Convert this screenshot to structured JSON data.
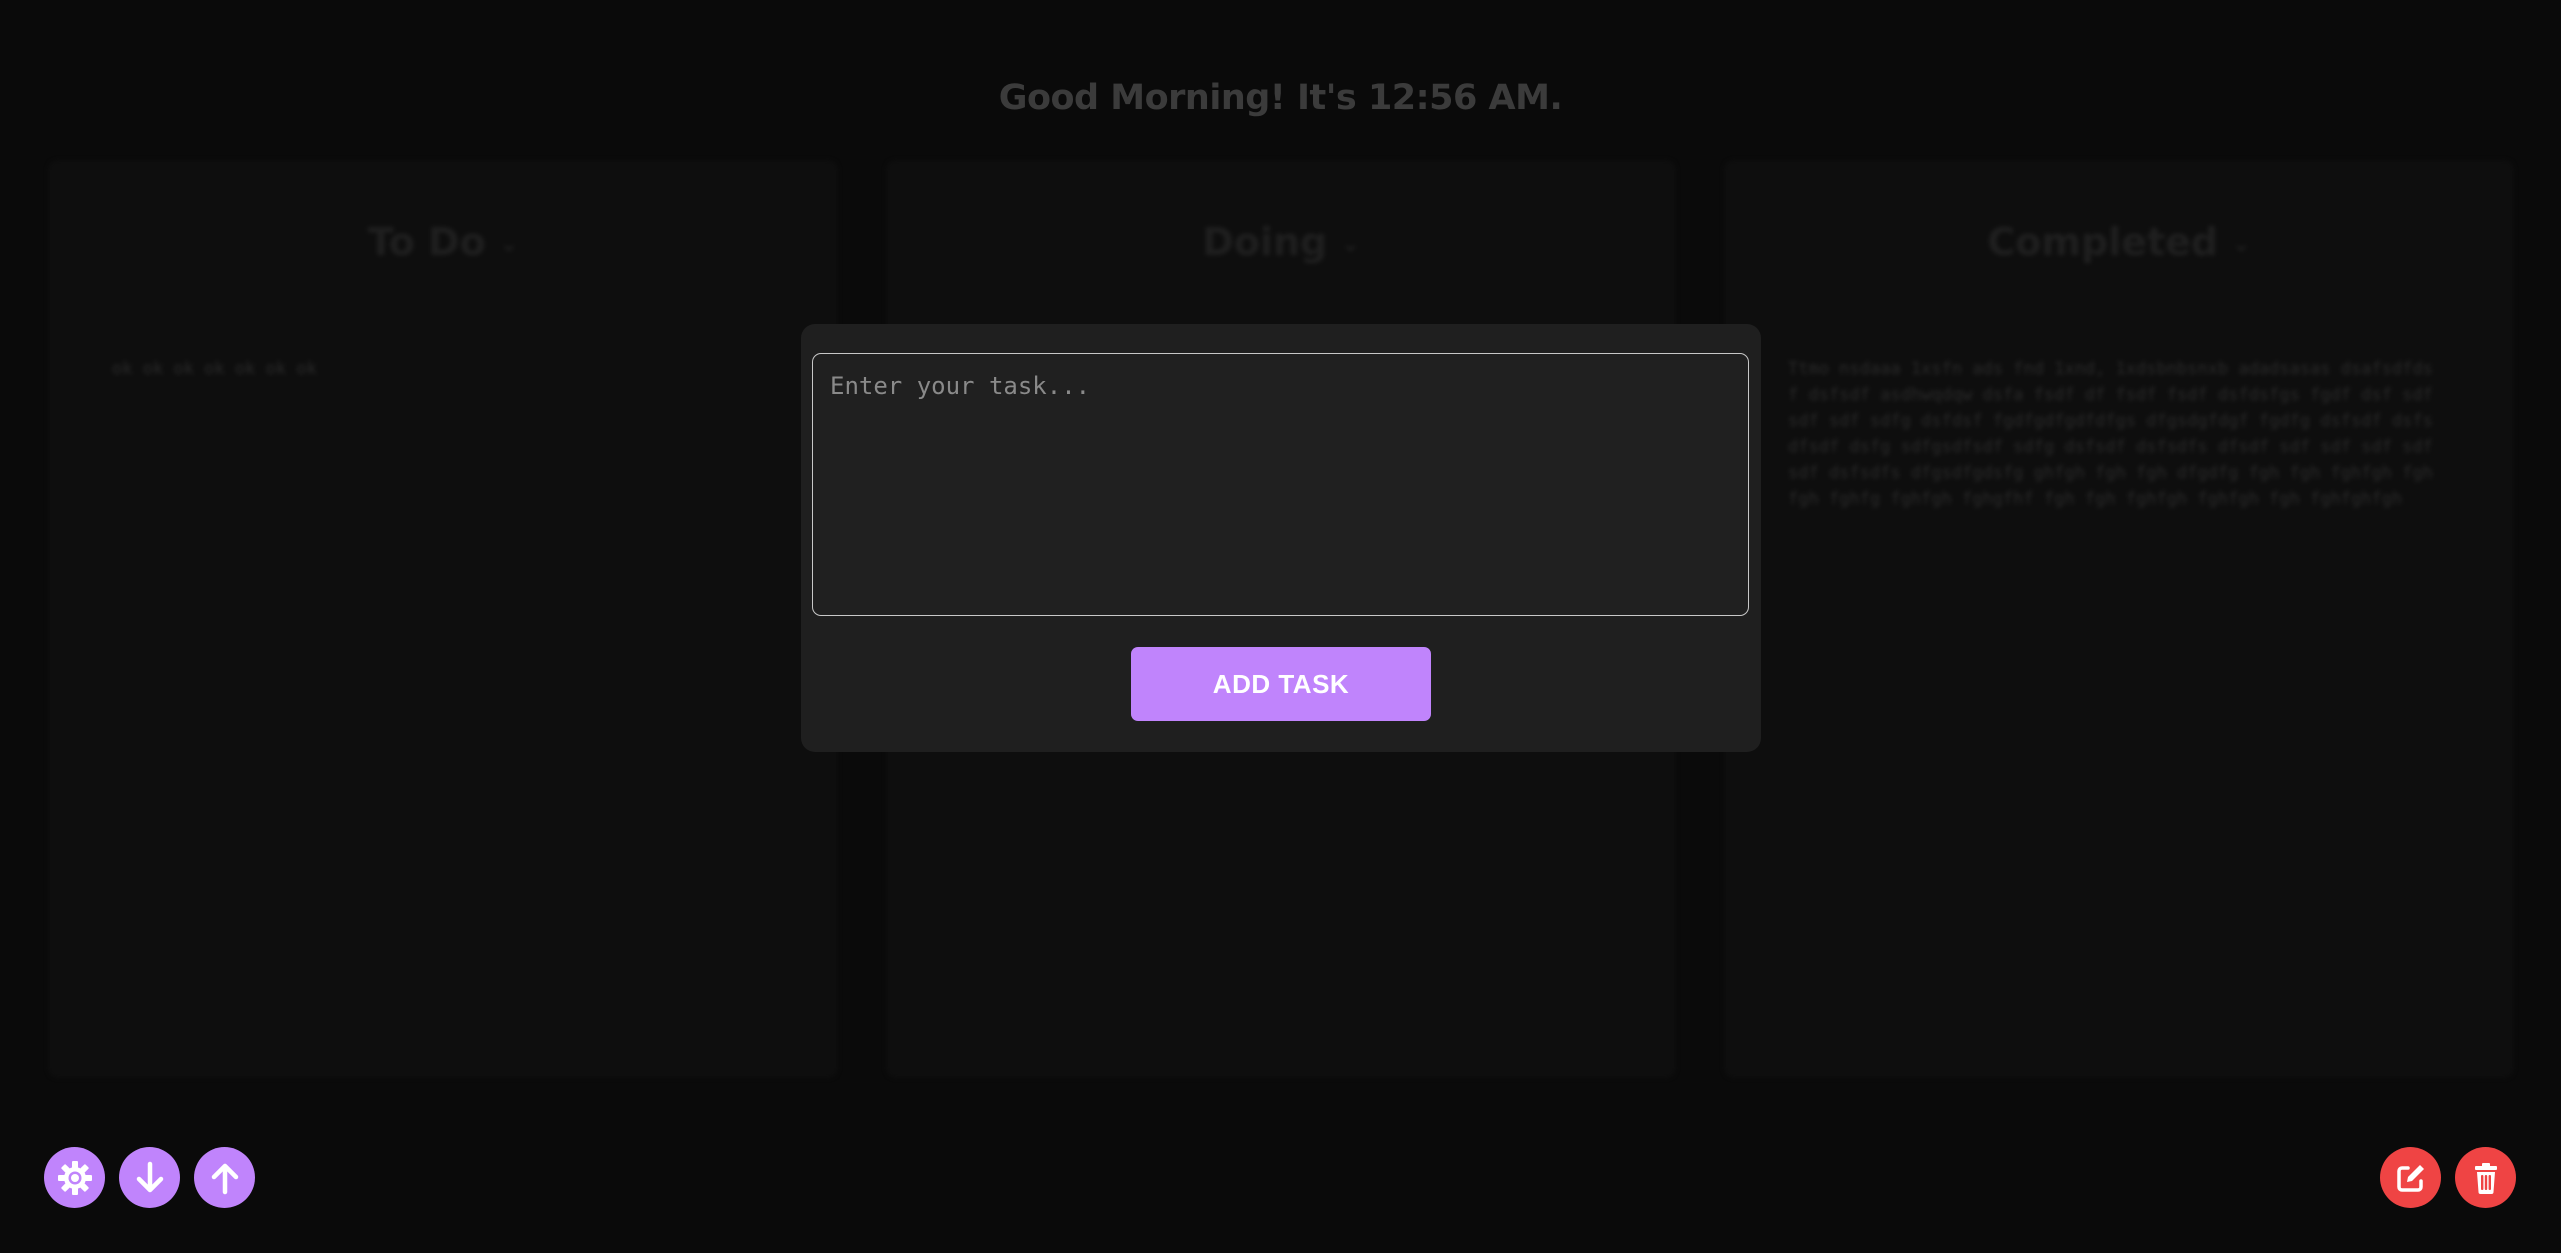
{
  "header": {
    "greeting": "Good Morning! It's 12:56 AM."
  },
  "columns": [
    {
      "title": "To Do",
      "task_text": "ok ok ok ok ok ok ok"
    },
    {
      "title": "Doing",
      "task_text": ""
    },
    {
      "title": "Completed",
      "task_text": "Ttmo nsdaaa 1xsfn ads fnd 1xnd, 1xdsbnbsnxb adadsasas dsafsdfdsf dsfsdf asdhwqdqw dsfa fsdf df fsdf fsdf dsfdsfgs fgdf dsf sdfsdf sdf sdfg dsfdsf fgdfgdfgdfdfgs dfgsdgfdgf fgdfg dsfsdf dsfsdfsdf dsfg sdfgsdfsdf sdfg dsfsdf dsfsdfs dfsdf sdf sdf sdf sdfsdf dsfsdfs dfgsdfgdsfg ghfgh fgh fgh dfgdfg fgh fgh fghfgh fghfgh fghfg fghfgh fghgfhf fgh fgh fghfgh fghfgh fgh fghfghfgh"
    }
  ],
  "modal": {
    "input_placeholder": "Enter your task...",
    "input_value": "",
    "add_button_label": "ADD TASK"
  },
  "toolbar_left": [
    {
      "name": "settings",
      "icon": "gear-icon"
    },
    {
      "name": "download",
      "icon": "arrow-down-icon"
    },
    {
      "name": "upload",
      "icon": "arrow-up-icon"
    }
  ],
  "toolbar_right": [
    {
      "name": "edit",
      "icon": "edit-icon"
    },
    {
      "name": "delete",
      "icon": "trash-icon"
    }
  ],
  "colors": {
    "accent": "#c084fc",
    "danger": "#ef4444",
    "background": "#0a0a0a",
    "modal_background": "#1f1f1f"
  }
}
